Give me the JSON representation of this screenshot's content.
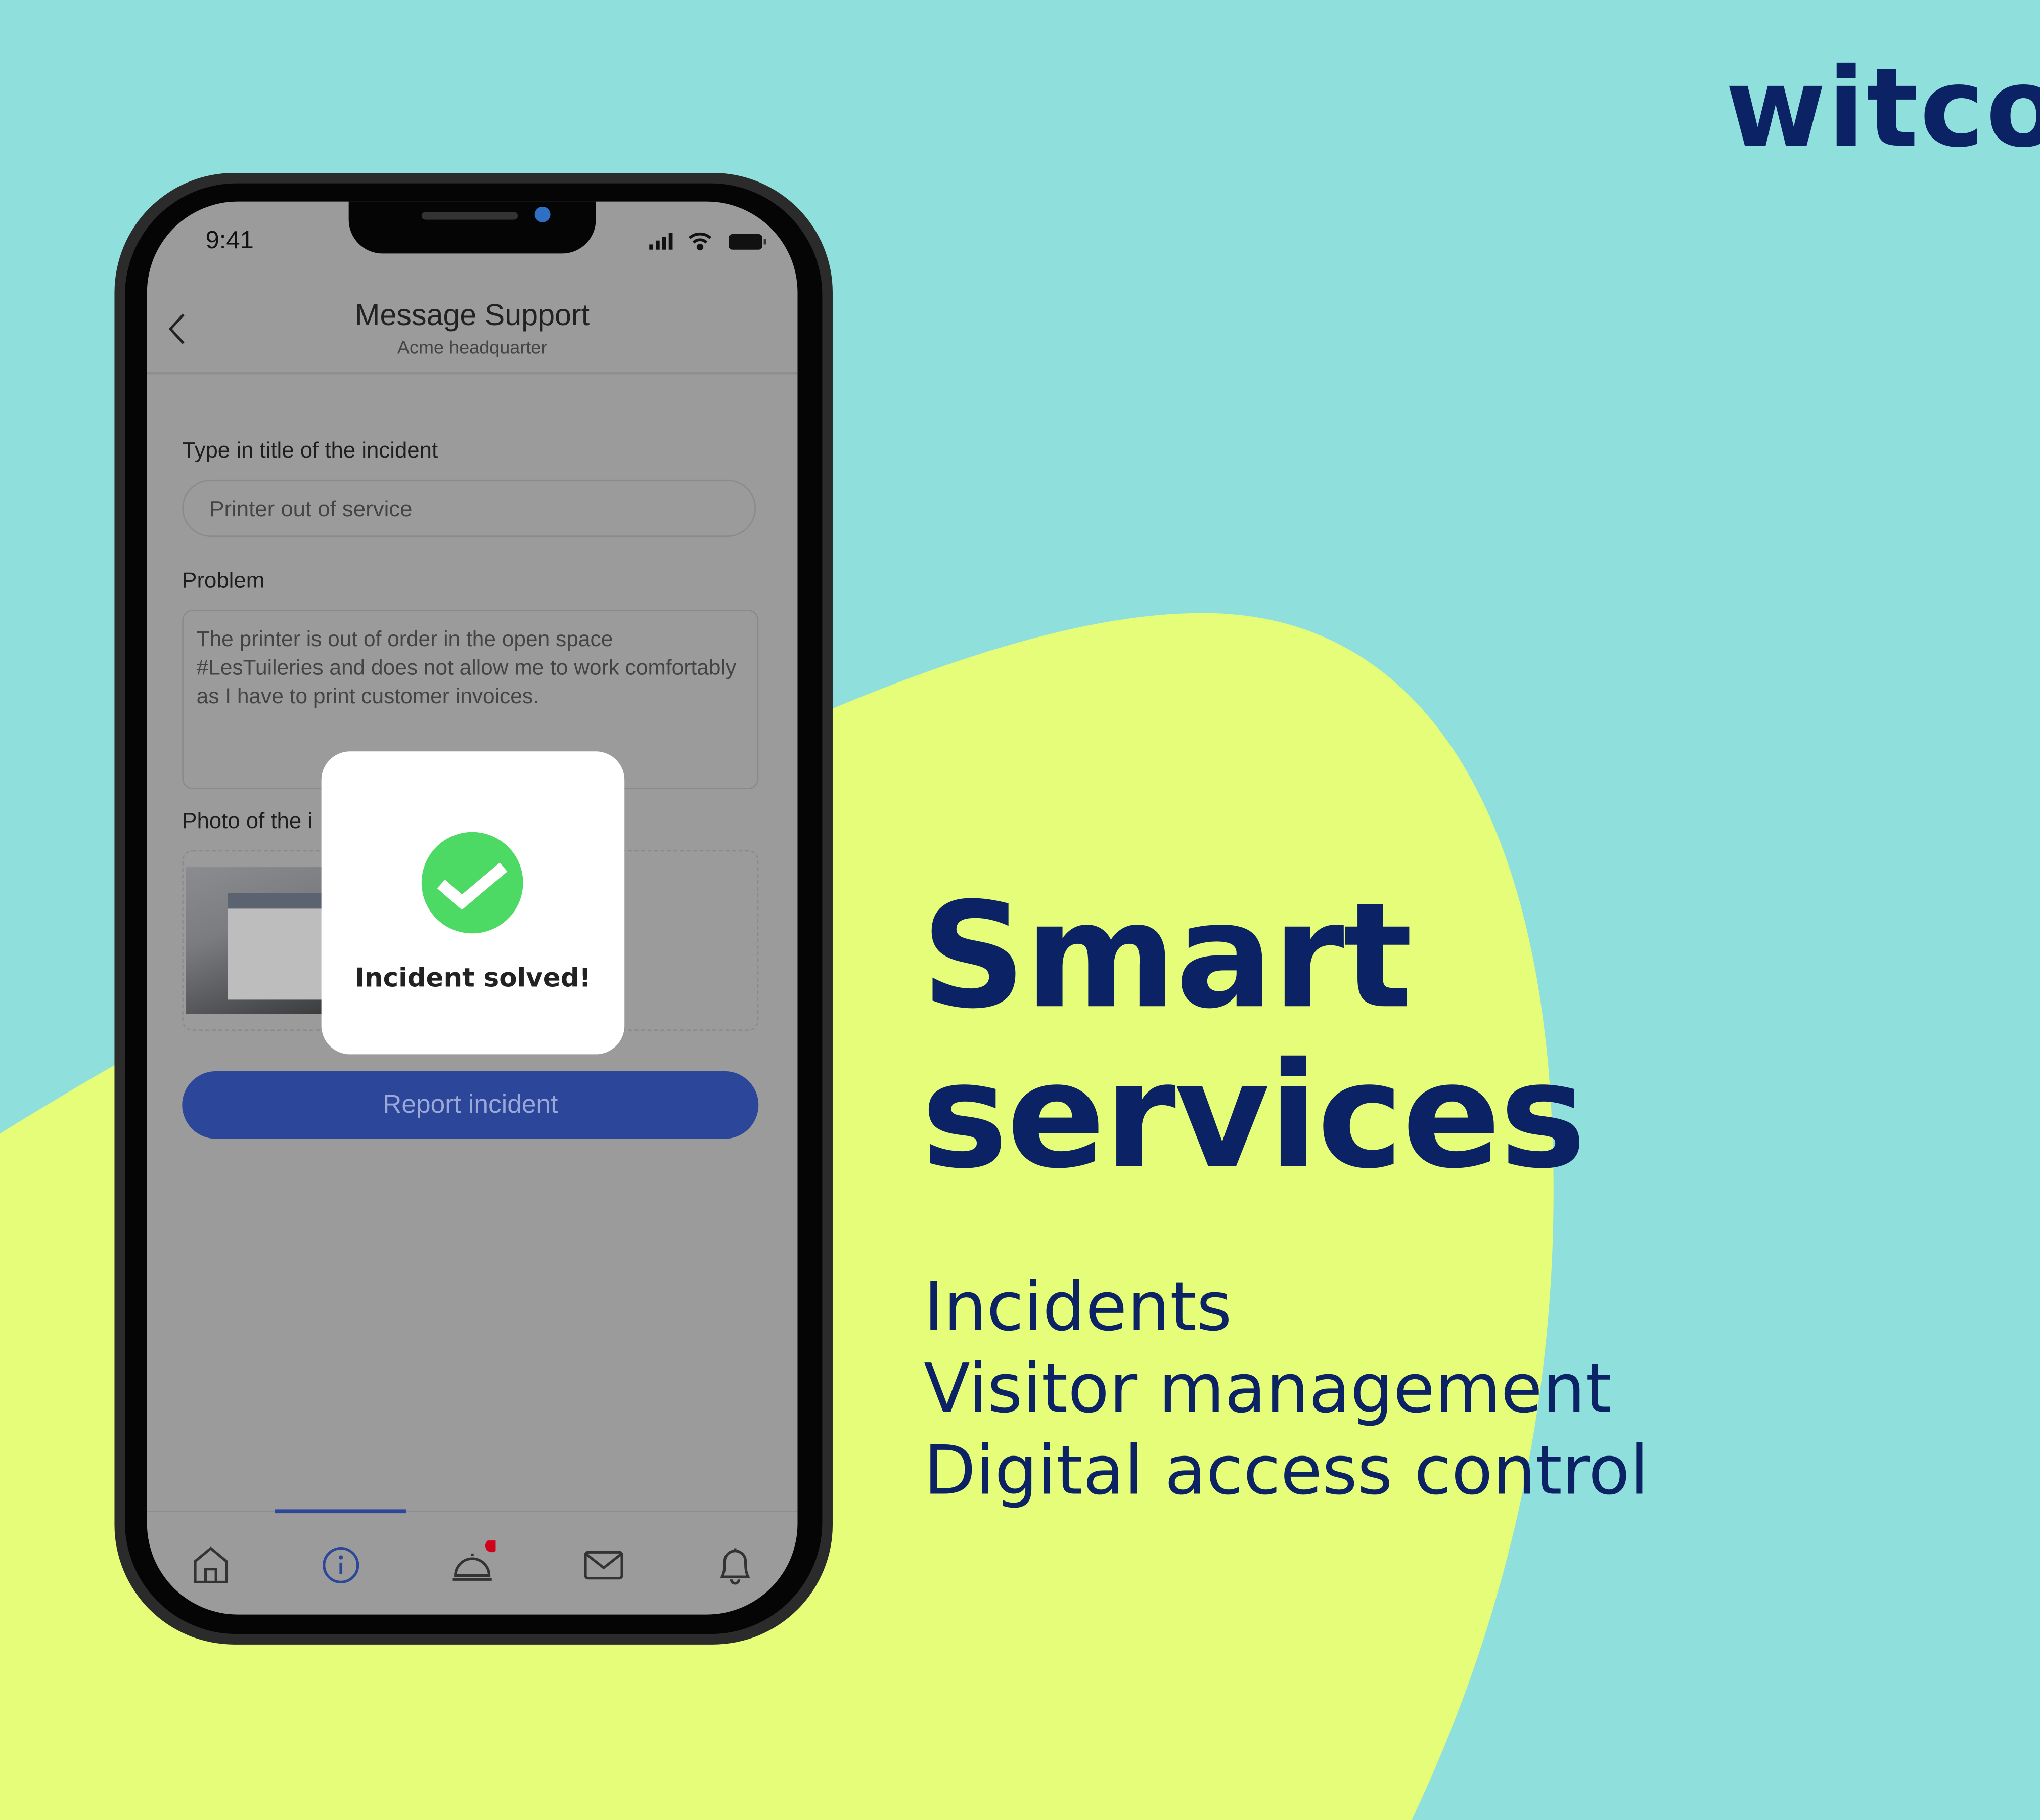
{
  "brand": {
    "logo": "witco",
    "navy": "#0b2265",
    "teal": "#8fe0dc",
    "yellow": "#e6fd7a"
  },
  "phone": {
    "status_bar": {
      "time": "9:41",
      "icons": [
        "signal-icon",
        "wifi-icon",
        "battery-icon"
      ]
    },
    "header": {
      "title": "Message Support",
      "subtitle": "Acme headquarter",
      "back_icon": "chevron-left-icon"
    },
    "form": {
      "title_label": "Type in title of the incident",
      "title_value": "Printer out of service",
      "problem_label": "Problem",
      "problem_value": "The printer is out of order in the open space #LesTuileries and does not allow me to work comfortably as I have to print customer invoices.",
      "photo_label": "Photo of the i",
      "submit_label": "Report incident",
      "accent": "#2c4699"
    },
    "modal": {
      "message": "Incident solved!",
      "icon": "check-circle-icon",
      "icon_color": "#4cd964"
    },
    "tab_bar": {
      "items": [
        "home-icon",
        "info-icon",
        "concierge-bell-icon",
        "mail-icon",
        "bell-icon"
      ],
      "active_index": 1,
      "badge_color": "#d0021b"
    }
  },
  "marketing": {
    "headline": [
      "Smart",
      "services"
    ],
    "features": [
      "Incidents",
      "Visitor management",
      "Digital access control"
    ]
  }
}
